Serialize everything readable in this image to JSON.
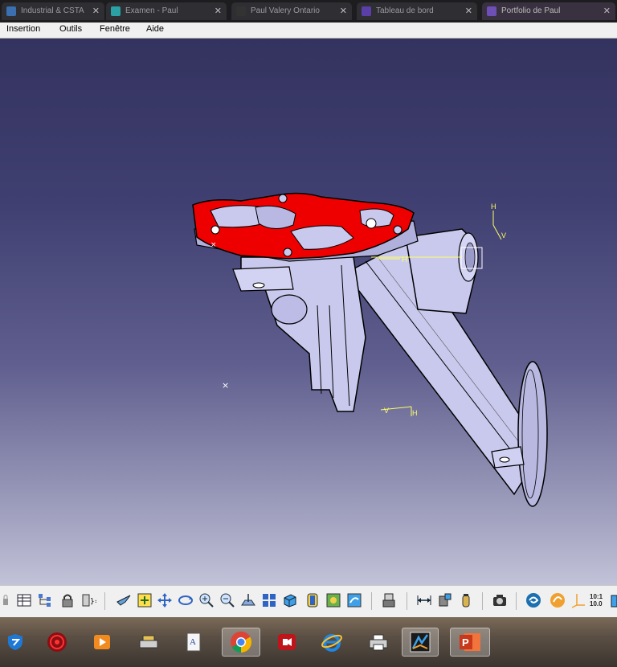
{
  "browser_tabs": [
    {
      "label": "Industrial & CSTA"
    },
    {
      "label": "Examen - Paul"
    },
    {
      "label": "Paul Valery Ontario"
    },
    {
      "label": "Tableau de bord"
    },
    {
      "label": "Portfolio de Paul"
    }
  ],
  "menu": {
    "insertion": "Insertion",
    "outils": "Outils",
    "fenetre": "Fenêtre",
    "aide": "Aide"
  },
  "viewport": {
    "compass_labels": {
      "h": "H",
      "v": "V"
    },
    "lower_labels": {
      "v": "V",
      "h": "H"
    },
    "part_labels": {
      "h": "H"
    },
    "part_highlight_color": "#ee0000",
    "part_body_color": "#c9c9ee"
  },
  "toolbar": {
    "icons": [
      "lock-icon",
      "table-icon",
      "tree-icon",
      "padlock-icon",
      "constraint-icon",
      "fly-icon",
      "fit-all-icon",
      "pan-icon",
      "rotate-icon",
      "zoom-in-icon",
      "zoom-out-icon",
      "normal-view-icon",
      "multi-view-icon",
      "isometric-view-icon",
      "shading-icon",
      "hide-show-icon",
      "swap-space-icon",
      "apply-material-icon",
      "measure-between-icon",
      "measure-item-icon",
      "measure-inertia-icon",
      "capture-icon",
      "catia-v5-icon",
      "sketch-tracer-icon",
      "axis-system-icon",
      "scale-icon",
      "grid-icon"
    ],
    "scale_label_top": "10:1",
    "scale_label_bottom": "10.0"
  },
  "taskbar": {
    "icons": [
      "windows-defender-icon",
      "antivirus-icon",
      "media-player-icon",
      "scanner-icon",
      "document-icon",
      "chrome-icon",
      "screen-recorder-icon",
      "internet-explorer-icon",
      "printer-icon",
      "catia-icon",
      "powerpoint-icon"
    ]
  }
}
